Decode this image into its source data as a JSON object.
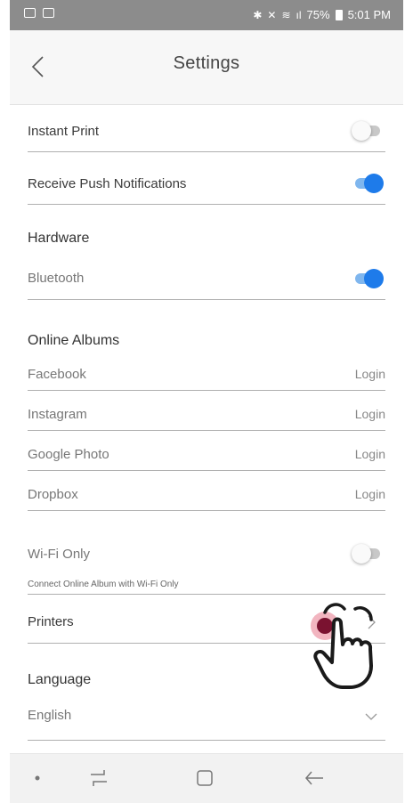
{
  "status_bar": {
    "battery": "75%",
    "time": "5:01 PM"
  },
  "header": {
    "title": "Settings"
  },
  "settings": {
    "instant_print": {
      "label": "Instant Print",
      "enabled": false
    },
    "push_notifications": {
      "label": "Receive Push Notifications",
      "enabled": true
    },
    "hardware": {
      "section": "Hardware",
      "bluetooth": {
        "label": "Bluetooth",
        "enabled": true
      }
    },
    "online_albums": {
      "section": "Online Albums",
      "items": [
        {
          "label": "Facebook",
          "action": "Login"
        },
        {
          "label": "Instagram",
          "action": "Login"
        },
        {
          "label": "Google Photo",
          "action": "Login"
        },
        {
          "label": "Dropbox",
          "action": "Login"
        }
      ],
      "wifi_only": {
        "label": "Wi-Fi Only",
        "enabled": false,
        "note": "Connect Online Album with Wi-Fi Only"
      }
    },
    "printers": {
      "label": "Printers"
    },
    "language": {
      "section": "Language",
      "value": "English"
    }
  },
  "colors": {
    "toggle_on": "#1e7bea",
    "toggle_on_track": "#7fb6ee",
    "status_bar": "#8c8c8c"
  },
  "icons": [
    "back-chevron-icon",
    "chevron-right-icon",
    "chevron-down-icon",
    "pointing-hand-icon"
  ]
}
